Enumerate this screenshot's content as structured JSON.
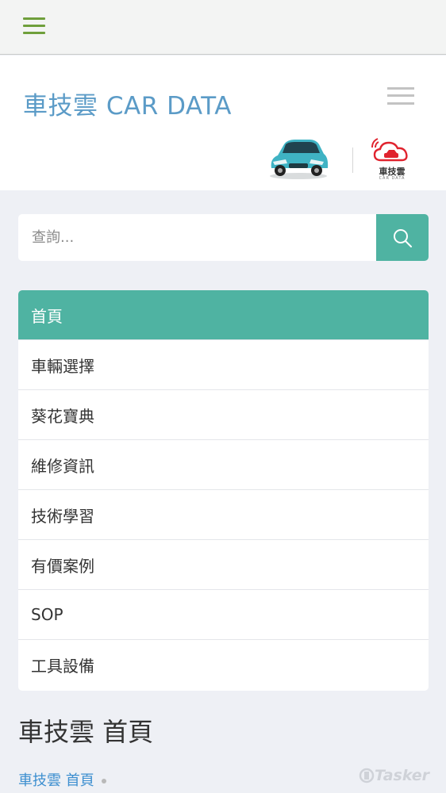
{
  "topbar": {
    "menu_icon": "hamburger-icon"
  },
  "header": {
    "title": "車技雲 CAR DATA",
    "menu_icon": "hamburger-icon",
    "logo_text": "車技雲",
    "logo_sub": "CAR DATA"
  },
  "search": {
    "placeholder": "查詢...",
    "value": "",
    "icon": "search-icon"
  },
  "menu": {
    "items": [
      {
        "label": "首頁",
        "active": true
      },
      {
        "label": "車輛選擇"
      },
      {
        "label": "葵花寶典"
      },
      {
        "label": "維修資訊"
      },
      {
        "label": "技術學習"
      },
      {
        "label": "有價案例"
      },
      {
        "label": "SOP"
      },
      {
        "label": "工具設備"
      }
    ]
  },
  "page": {
    "heading": "車技雲 首頁",
    "breadcrumb": "車技雲 首頁"
  },
  "watermark": "Tasker",
  "colors": {
    "accent": "#4fb3a2",
    "title_blue": "#5b9bc7",
    "link_blue": "#3d8fd0",
    "hamburger_green": "#6f9f3b"
  }
}
